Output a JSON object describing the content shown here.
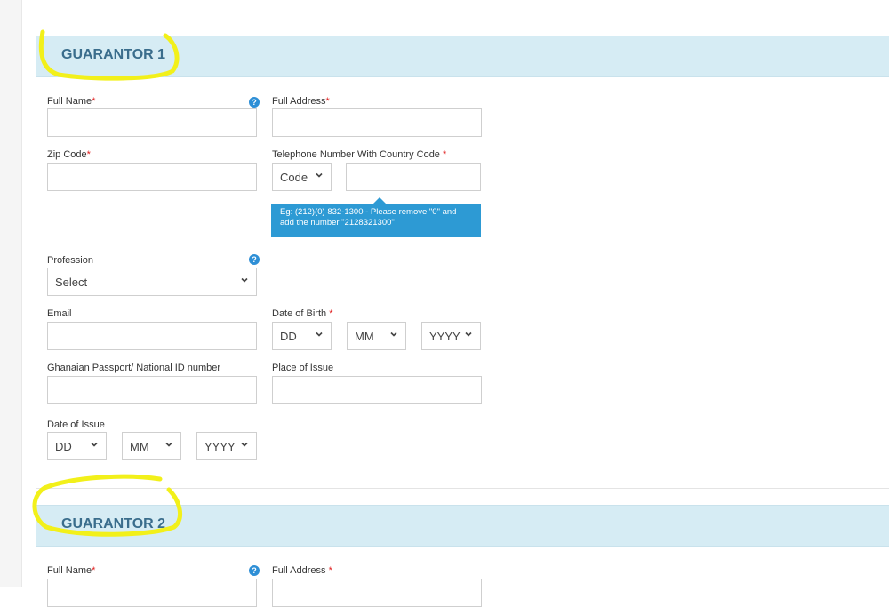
{
  "guarantor1": {
    "title": "GUARANTOR 1",
    "full_name_label": "Full Name",
    "full_address_label": "Full Address",
    "zip_label": "Zip Code",
    "phone_label": "Telephone Number With Country Code ",
    "code_select": "Code",
    "phone_tooltip": "Eg: (212)(0) 832-1300 - Please remove \"0\" and add the number \"2128321300\"",
    "profession_label": "Profession",
    "profession_select": "Select",
    "email_label": "Email",
    "dob_label": "Date of Birth ",
    "dob_dd": "DD",
    "dob_mm": "MM",
    "dob_yyyy": "YYYY",
    "passport_label": "Ghanaian Passport/ National ID number",
    "place_issue_label": "Place of Issue",
    "date_issue_label": "Date of Issue",
    "doi_dd": "DD",
    "doi_mm": "MM",
    "doi_yyyy": "YYYY"
  },
  "guarantor2": {
    "title": "GUARANTOR 2",
    "full_name_label": "Full Name",
    "full_address_label": "Full Address "
  },
  "required_mark": "*",
  "help_glyph": "?",
  "colors": {
    "header_bg": "#d6ecf4",
    "title": "#3a6d8c",
    "required": "#e02020",
    "tooltip": "#2d9ad4",
    "highlight": "#f2f01a"
  },
  "icons": {
    "help": "question-circle-icon",
    "dropdown": "chevron-down-icon"
  }
}
